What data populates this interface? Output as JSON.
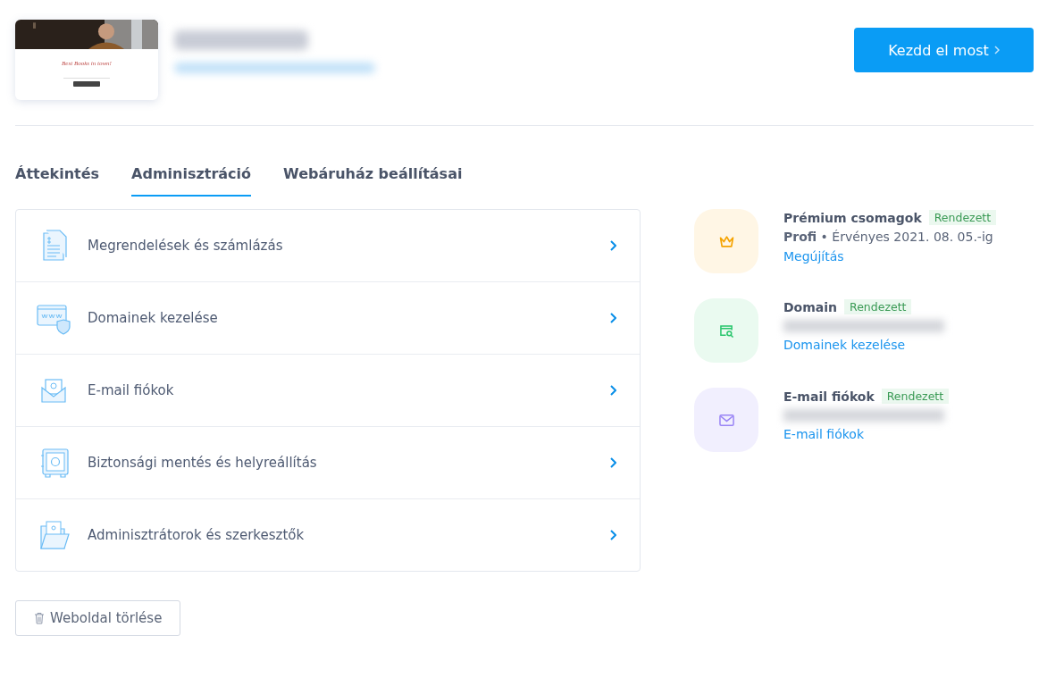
{
  "site": {
    "thumbnail_heading": "Best Books in town!",
    "start_button": "Kezdd el most"
  },
  "tabs": [
    {
      "label": "Áttekintés",
      "selected": false
    },
    {
      "label": "Adminisztráció",
      "selected": true
    },
    {
      "label": "Webáruház beállításai",
      "selected": false
    }
  ],
  "admin_items": [
    {
      "label": "Megrendelések és számlázás"
    },
    {
      "label": "Domainek kezelése"
    },
    {
      "label": "E-mail fiókok"
    },
    {
      "label": "Biztonsági mentés és helyreállítás"
    },
    {
      "label": "Adminisztrátorok és szerkesztők"
    }
  ],
  "services": [
    {
      "title": "Prémium csomagok",
      "status": "Rendezett",
      "color": "#fff6e5",
      "plan": "Profi",
      "detail": "• Érvényes 2021. 08. 05.-ig",
      "link": "Megújítás"
    },
    {
      "title": "Domain",
      "status": "Rendezett",
      "color": "#eafaf0",
      "link": "Domainek kezelése"
    },
    {
      "title": "E-mail fiókok",
      "status": "Rendezett",
      "color": "#f1effe",
      "link": "E-mail fiókok"
    }
  ],
  "delete_button": "Weboldal törlése"
}
